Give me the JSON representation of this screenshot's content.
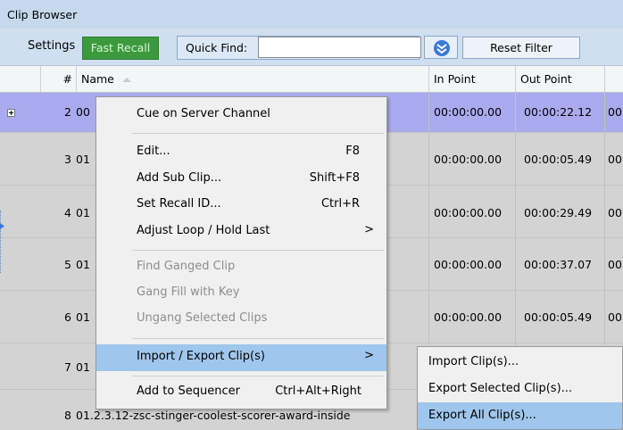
{
  "window": {
    "title": "Clip Browser"
  },
  "toolbar": {
    "settings_label": "Settings",
    "fast_recall_label": "Fast Recall",
    "quick_find_label": "Quick Find:",
    "quick_find_value": "",
    "reset_filter_label": "Reset Filter"
  },
  "table": {
    "headers": {
      "num": "#",
      "name": "Name",
      "in": "In Point",
      "out": "Out Point"
    },
    "rows": [
      {
        "num": "2",
        "name": "00",
        "in": "00:00:00.00",
        "out": "00:00:22.12",
        "next": "00"
      },
      {
        "num": "3",
        "name": "01",
        "in": "00:00:00.00",
        "out": "00:00:05.49",
        "next": "00"
      },
      {
        "num": "4",
        "name": "01",
        "in": "00:00:00.00",
        "out": "00:00:29.49",
        "next": "00"
      },
      {
        "num": "5",
        "name": "01",
        "in": "00:00:00.00",
        "out": "00:00:37.07",
        "next": "00"
      },
      {
        "num": "6",
        "name": "01",
        "in": "00:00:00.00",
        "out": "00:00:05.49",
        "next": "00"
      },
      {
        "num": "7",
        "name": "01",
        "in": "",
        "out": "",
        "next": ""
      },
      {
        "num": "8",
        "name": "01.2.3.12-zsc-stinger-coolest-scorer-award-inside",
        "in": "",
        "out": "",
        "next": ""
      }
    ]
  },
  "context_menu": {
    "cue": "Cue on Server Channel",
    "edit": "Edit...",
    "edit_sc": "F8",
    "add_sub": "Add Sub Clip...",
    "add_sub_sc": "Shift+F8",
    "set_recall": "Set Recall ID...",
    "set_recall_sc": "Ctrl+R",
    "adjust_loop": "Adjust Loop / Hold Last",
    "find_ganged": "Find Ganged Clip",
    "gang_fill": "Gang Fill with Key",
    "ungang": "Ungang Selected Clips",
    "import_export": "Import / Export Clip(s)",
    "add_seq": "Add to Sequencer",
    "add_seq_sc": "Ctrl+Alt+Right",
    "arrow": ">"
  },
  "submenu": {
    "import": "Import Clip(s)...",
    "export_selected": "Export Selected Clip(s)...",
    "export_all": "Export All Clip(s)..."
  },
  "colors": {
    "titlebar": "#c6d8ec",
    "toolbar": "#cfdff0",
    "fast_recall": "#3c9a3c",
    "selected_row": "#aaaaee",
    "row": "#d3d3d3",
    "menu_highlight": "#9fc6ec"
  },
  "icons": [
    "expand-plus-icon",
    "double-chevron-down-icon",
    "sort-arrow-icon",
    "submenu-arrow-icon"
  ]
}
